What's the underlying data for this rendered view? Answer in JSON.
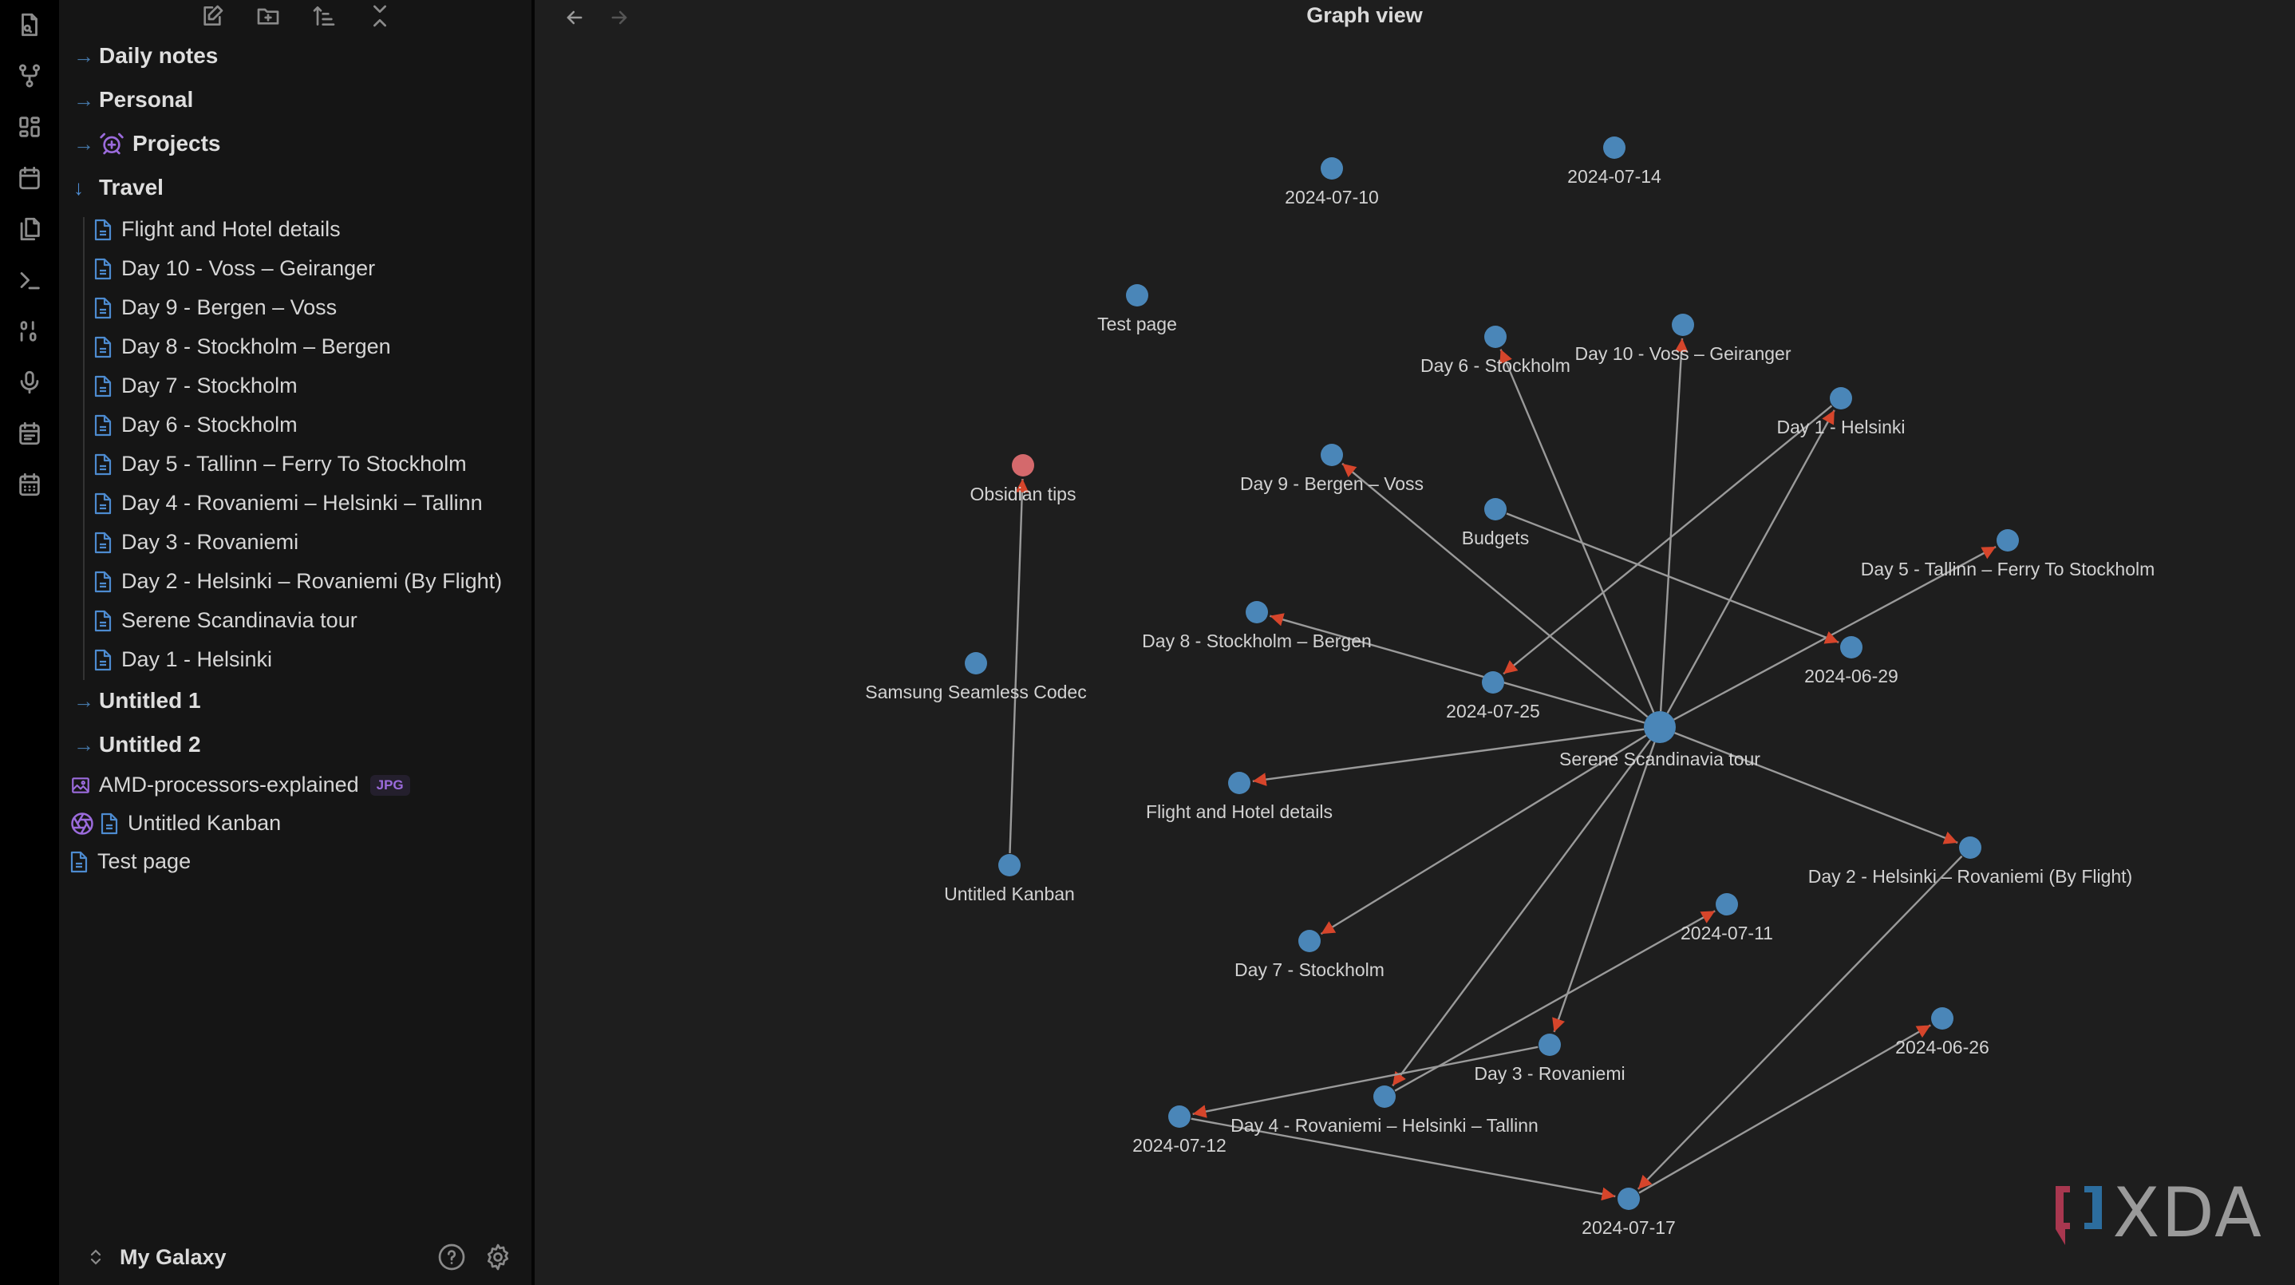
{
  "ribbon": {
    "icons": [
      "search-file-icon",
      "graph-icon",
      "dashboard-icon",
      "calendar-icon",
      "copy-icon",
      "terminal-icon",
      "binary-icon",
      "microphone-icon",
      "calendar-list-icon",
      "calendar-grid-icon"
    ]
  },
  "toolbar": {
    "buttons": [
      "new-note",
      "new-folder",
      "change-sort-order",
      "collapse-all"
    ]
  },
  "tree": {
    "folders_top": [
      {
        "label": "Daily notes",
        "expanded": false
      },
      {
        "label": "Personal",
        "expanded": false
      },
      {
        "label": "Projects",
        "expanded": false,
        "icon": "alarm-plus-icon"
      },
      {
        "label": "Travel",
        "expanded": true
      }
    ],
    "travel_files": [
      "Flight and Hotel details",
      "Day 10 - Voss – Geiranger",
      "Day 9 - Bergen – Voss",
      "Day 8 - Stockholm – Bergen",
      "Day 7 - Stockholm",
      "Day 6 - Stockholm",
      "Day 5 - Tallinn – Ferry To Stockholm",
      "Day 4 - Rovaniemi – Helsinki – Tallinn",
      "Day 3 - Rovaniemi",
      "Day 2 - Helsinki – Rovaniemi (By Flight)",
      "Serene Scandinavia tour",
      "Day 1 - Helsinki"
    ],
    "folders_bottom": [
      {
        "label": "Untitled 1",
        "expanded": false
      },
      {
        "label": "Untitled 2",
        "expanded": false
      }
    ],
    "root_files": [
      {
        "label": "AMD-processors-explained",
        "badge": "JPG",
        "icon": "image-icon"
      },
      {
        "label": "Untitled Kanban",
        "icon": "kanban-aperture-icon"
      },
      {
        "label": "Test page",
        "icon": "file-icon"
      }
    ]
  },
  "vault": {
    "name": "My Galaxy"
  },
  "header": {
    "title": "Graph view"
  },
  "colors": {
    "node": "#4a86b8",
    "node_highlight": "#d4696c",
    "edge": "#9a9a9a",
    "arrow": "#d6452b",
    "accent_purple": "#9b6bdc",
    "file_icon": "#4d8bd0"
  },
  "graph": {
    "nodes": [
      {
        "id": "d0710",
        "label": "2024-07-10"
      },
      {
        "id": "d0714",
        "label": "2024-07-14"
      },
      {
        "id": "test",
        "label": "Test page"
      },
      {
        "id": "day6",
        "label": "Day 6 - Stockholm"
      },
      {
        "id": "day10",
        "label": "Day 10 - Voss – Geiranger"
      },
      {
        "id": "day1",
        "label": "Day 1 - Helsinki"
      },
      {
        "id": "tips",
        "label": "Obsidian tips",
        "highlight": true
      },
      {
        "id": "day9",
        "label": "Day 9 - Bergen – Voss"
      },
      {
        "id": "budgets",
        "label": "Budgets"
      },
      {
        "id": "day5",
        "label": "Day 5 - Tallinn – Ferry To Stockholm"
      },
      {
        "id": "day8",
        "label": "Day 8 - Stockholm – Bergen"
      },
      {
        "id": "samsung",
        "label": "Samsung Seamless Codec"
      },
      {
        "id": "d0629",
        "label": "2024-06-29"
      },
      {
        "id": "d0725",
        "label": "2024-07-25"
      },
      {
        "id": "serene",
        "label": "Serene Scandinavia tour",
        "hub": true
      },
      {
        "id": "flight",
        "label": "Flight and Hotel details"
      },
      {
        "id": "kanban",
        "label": "Untitled Kanban"
      },
      {
        "id": "day2",
        "label": "Day 2 - Helsinki – Rovaniemi (By Flight)"
      },
      {
        "id": "d0711",
        "label": "2024-07-11"
      },
      {
        "id": "day7",
        "label": "Day 7 - Stockholm"
      },
      {
        "id": "d0626",
        "label": "2024-06-26"
      },
      {
        "id": "day3",
        "label": "Day 3 - Rovaniemi"
      },
      {
        "id": "day4",
        "label": "Day 4 - Rovaniemi – Helsinki – Tallinn"
      },
      {
        "id": "d0712",
        "label": "2024-07-12"
      },
      {
        "id": "d0717",
        "label": "2024-07-17"
      }
    ],
    "edges": [
      [
        "serene",
        "day6"
      ],
      [
        "serene",
        "day10"
      ],
      [
        "serene",
        "day1"
      ],
      [
        "serene",
        "day9"
      ],
      [
        "serene",
        "day5"
      ],
      [
        "serene",
        "day8"
      ],
      [
        "serene",
        "flight"
      ],
      [
        "serene",
        "day2"
      ],
      [
        "serene",
        "day7"
      ],
      [
        "serene",
        "day4"
      ],
      [
        "serene",
        "day3"
      ],
      [
        "day1",
        "d0725"
      ],
      [
        "budgets",
        "d0629"
      ],
      [
        "kanban",
        "tips"
      ],
      [
        "day4",
        "d0711"
      ],
      [
        "day3",
        "d0712"
      ],
      [
        "d0712",
        "d0717"
      ],
      [
        "day2",
        "d0717"
      ],
      [
        "d0717",
        "d0626"
      ]
    ]
  },
  "watermark": {
    "text": "XDA"
  }
}
